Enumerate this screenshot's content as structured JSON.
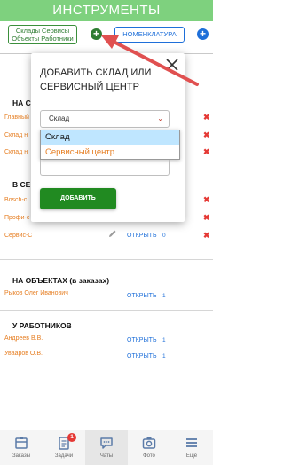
{
  "header": {
    "title": "ИНСТРУМЕНТЫ"
  },
  "toolbar": {
    "sklady_line1": "Склады Сервисы",
    "sklady_line2": "Объекты Работники",
    "nomenclature_label": "НОМЕНКЛАТУРА",
    "add_green": "+",
    "add_blue": "+"
  },
  "sections": {
    "s1": {
      "title": "НА С",
      "rows": [
        {
          "name": "Главный"
        },
        {
          "name": "Склад н"
        },
        {
          "name": "Склад н"
        }
      ]
    },
    "s2": {
      "title": "В СЕ",
      "rows": [
        {
          "name": "Bosch-c"
        },
        {
          "name": "Профи-с"
        },
        {
          "name": "Сервис-С",
          "open": "ОТКРЫТЬ",
          "count": "0"
        }
      ]
    },
    "objects": {
      "title": "НА ОБЪЕКТАХ (в заказах)",
      "rows": [
        {
          "name": "Рыков Олег Иванович",
          "open": "ОТКРЫТЬ",
          "count": "1"
        }
      ]
    },
    "workers": {
      "title": "У РАБОТНИКОВ",
      "rows": [
        {
          "name": "Андреев В.В.",
          "open": "ОТКРЫТЬ",
          "count": "1"
        },
        {
          "name": "Увааров О.В.",
          "open": "ОТКРЫТЬ",
          "count": "1"
        }
      ]
    },
    "delete_symbol": "✖"
  },
  "modal": {
    "title": "ДОБАВИТЬ СКЛАД или СЕРВИСНЫЙ ЦЕНТР",
    "select_value": "Склад",
    "options": [
      "Склад",
      "Сервисный центр"
    ],
    "add_button": "ДОБАВИТЬ"
  },
  "nav": {
    "items": [
      {
        "label": "Заказы",
        "icon": "orders-icon"
      },
      {
        "label": "Задачи",
        "icon": "tasks-icon",
        "badge": "1"
      },
      {
        "label": "Чаты",
        "icon": "chat-icon"
      },
      {
        "label": "Фото",
        "icon": "camera-icon"
      },
      {
        "label": "Ещё",
        "icon": "menu-icon"
      }
    ]
  },
  "colors": {
    "header_bg": "#7ed17e",
    "primary_green": "#218a21",
    "link_blue": "#1e6fd9",
    "name_orange": "#e67e22",
    "delete_red": "#e53935",
    "arrow_red": "#e05050"
  }
}
